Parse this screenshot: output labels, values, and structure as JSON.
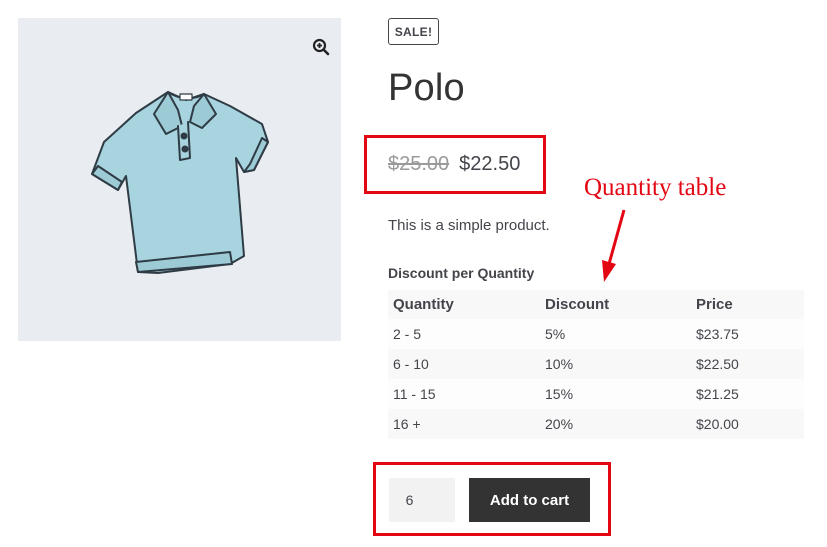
{
  "product": {
    "sale_badge": "SALE!",
    "title": "Polo",
    "price_old": "$25.00",
    "price_new": "$22.50",
    "description": "This is a simple product."
  },
  "gallery": {
    "zoom_icon": "magnifier-plus-icon"
  },
  "annotation": {
    "label": "Quantity table",
    "color": "#e30613"
  },
  "quantity_table": {
    "caption": "Discount per Quantity",
    "headers": [
      "Quantity",
      "Discount",
      "Price"
    ],
    "rows": [
      [
        "2 - 5",
        "5%",
        "$23.75"
      ],
      [
        "6 - 10",
        "10%",
        "$22.50"
      ],
      [
        "11 - 15",
        "15%",
        "$21.25"
      ],
      [
        "16 +",
        "20%",
        "$20.00"
      ]
    ]
  },
  "cart": {
    "quantity_value": "6",
    "add_label": "Add to cart"
  },
  "colors": {
    "button": "#333333",
    "highlight": "#e30613",
    "gallery_bg": "#e9edf1"
  }
}
